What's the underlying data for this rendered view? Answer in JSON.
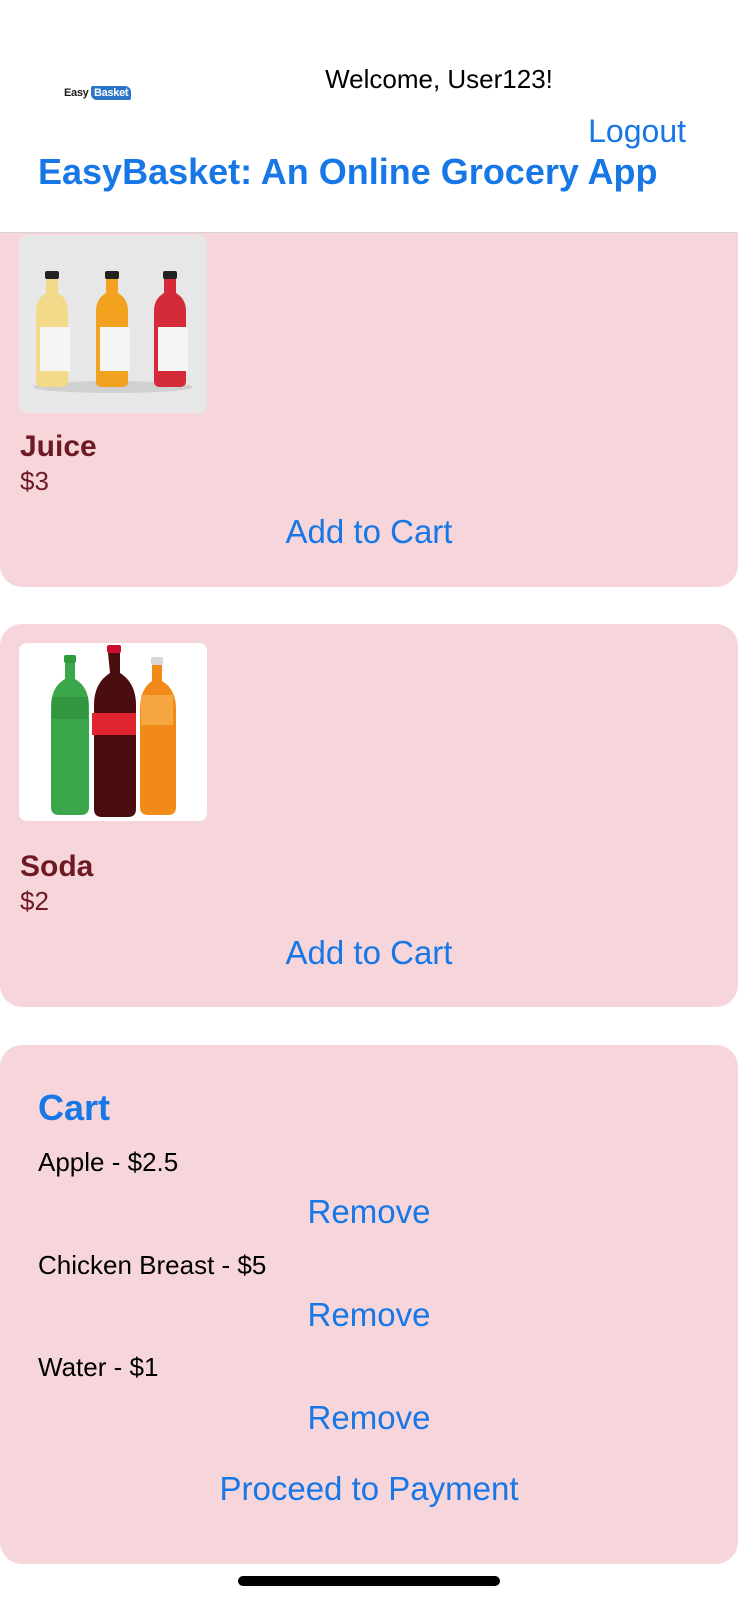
{
  "header": {
    "logo_text_1": "Easy",
    "logo_text_2": "Basket",
    "welcome": "Welcome, User123!",
    "logout_label": "Logout",
    "title": "EasyBasket: An Online Grocery App"
  },
  "products": [
    {
      "name": "Juice",
      "price": "$3",
      "add_label": "Add to Cart"
    },
    {
      "name": "Soda",
      "price": "$2",
      "add_label": "Add to Cart"
    }
  ],
  "cart": {
    "title": "Cart",
    "items": [
      {
        "label": "Apple - $2.5",
        "remove_label": "Remove"
      },
      {
        "label": "Chicken Breast - $5",
        "remove_label": "Remove"
      },
      {
        "label": "Water - $1",
        "remove_label": "Remove"
      }
    ],
    "proceed_label": "Proceed to Payment"
  },
  "colors": {
    "accent": "#1877e6",
    "card_bg": "#f6d6da",
    "product_text": "#6e1a24"
  }
}
